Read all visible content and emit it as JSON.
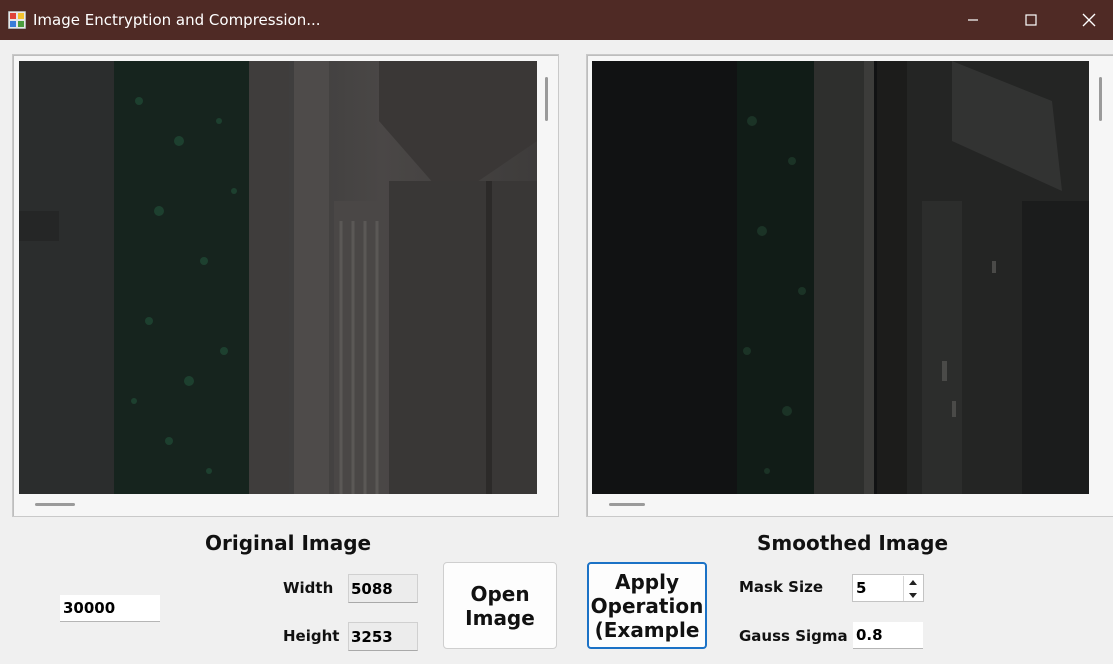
{
  "window": {
    "title": "Image Enctryption and Compression...",
    "titlebar_color": "#4f2a25",
    "icons": [
      "app-icon",
      "minimize-icon",
      "maximize-icon",
      "close-icon"
    ]
  },
  "left": {
    "heading": "Original Image",
    "seed_value": "30000",
    "width_label": "Width",
    "width_value": "5088",
    "height_label": "Height",
    "height_value": "3253",
    "open_button": "Open Image"
  },
  "right": {
    "heading": "Smoothed Image",
    "apply_button": "Apply Operation (Example",
    "mask_label": "Mask Size",
    "mask_value": "5",
    "sigma_label": "Gauss Sigma",
    "sigma_value": "0.8"
  },
  "colors": {
    "focus_border": "#1b72c6",
    "background": "#f0f0f0"
  }
}
